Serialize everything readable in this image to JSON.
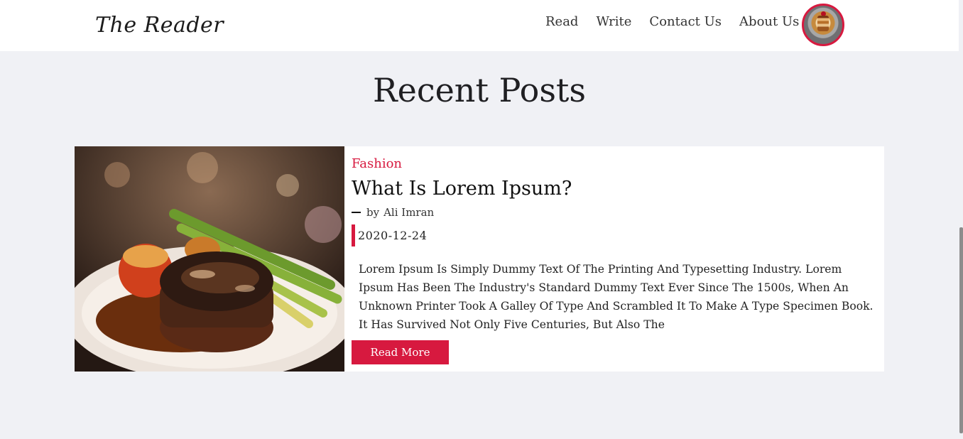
{
  "header": {
    "logo": "The Reader",
    "nav": [
      "Read",
      "Write",
      "Contact Us",
      "About Us"
    ]
  },
  "section": {
    "title": "Recent Posts"
  },
  "post": {
    "category": "Fashion",
    "title": "What Is Lorem Ipsum?",
    "by": "by",
    "author": "Ali Imran",
    "date": "2020-12-24",
    "excerpt": "Lorem Ipsum Is Simply Dummy Text Of The Printing And Typesetting Industry. Lorem Ipsum Has Been The Industry's Standard Dummy Text Ever Since The 1500s, When An Unknown Printer Took A Galley Of Type And Scrambled It To Make A Type Specimen Book. It Has Survived Not Only Five Centuries, But Also The",
    "read_more": "Read More"
  },
  "colors": {
    "accent": "#d7193f",
    "background": "#f0f1f5",
    "header_bg": "#ffffff"
  },
  "icons": {
    "avatar": "user-avatar-dessert-photo",
    "post_image": "steak-dinner-photo"
  }
}
